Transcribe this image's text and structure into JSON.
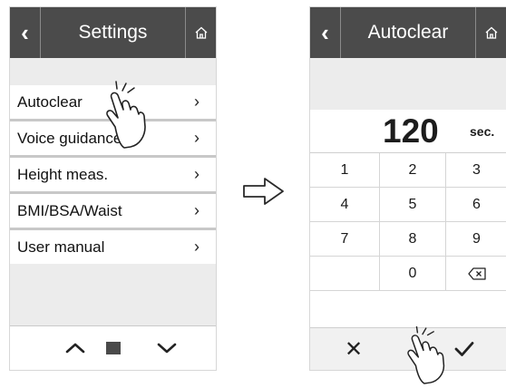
{
  "settings_screen": {
    "header": {
      "back_icon": "chevron-left-icon",
      "title": "Settings",
      "home_icon": "home-icon"
    },
    "menu_items": [
      {
        "label": "Autoclear",
        "chevron": "›"
      },
      {
        "label": "Voice guidance",
        "chevron": "›"
      },
      {
        "label": "Height meas.",
        "chevron": "›"
      },
      {
        "label": "BMI/BSA/Waist",
        "chevron": "›"
      },
      {
        "label": "User manual",
        "chevron": "›"
      }
    ],
    "nav": {
      "up_icon": "chevron-up-icon",
      "down_icon": "chevron-down-icon",
      "indicator": "page-indicator"
    }
  },
  "transition": {
    "icon": "right-arrow-icon"
  },
  "autoclear_screen": {
    "header": {
      "back_icon": "chevron-left-icon",
      "title": "Autoclear",
      "home_icon": "home-icon"
    },
    "display": {
      "value": "120",
      "unit": "sec."
    },
    "keys": [
      [
        "1",
        "2",
        "3"
      ],
      [
        "4",
        "5",
        "6"
      ],
      [
        "7",
        "8",
        "9"
      ],
      [
        "",
        "0",
        "⌫"
      ]
    ],
    "actions": {
      "cancel": "✕",
      "confirm_icon": "checkmark-icon"
    }
  },
  "colors": {
    "header": "#4b4b4b",
    "background": "#ececec",
    "row": "#ffffff"
  }
}
